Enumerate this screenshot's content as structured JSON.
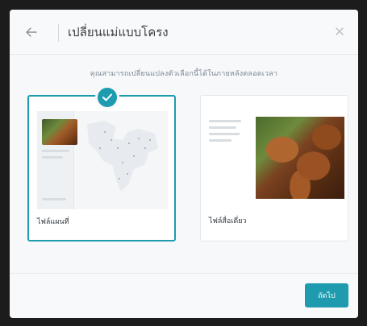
{
  "dialog": {
    "title": "เปลี่ยนแม่แบบโครง",
    "subtitle": "คุณสามารถเปลี่ยนแปลงตัวเลือกนี้ได้ในภายหลังตลอดเวลา",
    "back_icon": "arrow-left-icon",
    "close_icon": "close-icon"
  },
  "cards": [
    {
      "label": "ไฟล์แผนที่",
      "selected": true,
      "check_icon": "checkmark-icon"
    },
    {
      "label": "ไฟล์สื่อเดี่ยว",
      "selected": false
    }
  ],
  "footer": {
    "next_label": "ถัดไป"
  },
  "colors": {
    "accent": "#1f9bb0"
  }
}
